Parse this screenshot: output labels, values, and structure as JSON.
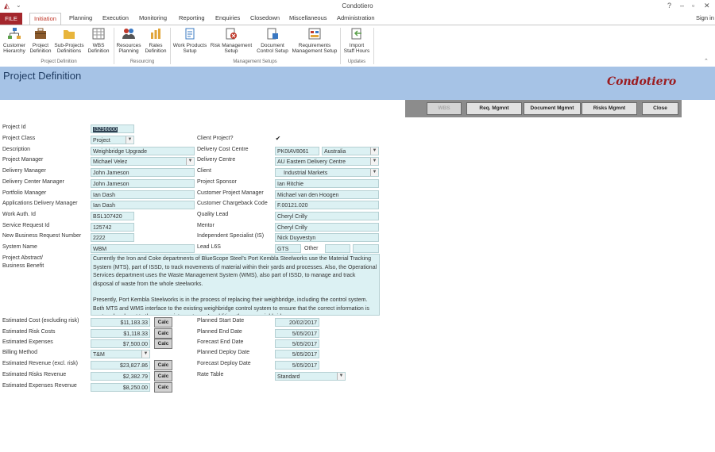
{
  "app": {
    "title": "Condotiero",
    "help": "?",
    "sign_in": "Sign in"
  },
  "tabs": [
    "FILE",
    "Initiation",
    "Planning",
    "Execution",
    "Monitoring",
    "Reporting",
    "Enquiries",
    "Closedown",
    "Miscellaneous",
    "Administration"
  ],
  "ribbon": {
    "buttons": [
      {
        "line1": "Customer",
        "line2": "Hierarchy"
      },
      {
        "line1": "Project",
        "line2": "Definition"
      },
      {
        "line1": "Sub-Projects",
        "line2": "Definitions"
      },
      {
        "line1": "WBS",
        "line2": "Definition"
      },
      {
        "line1": "Resources",
        "line2": "Planning"
      },
      {
        "line1": "Rates",
        "line2": "Definition"
      },
      {
        "line1": "Work Products",
        "line2": "Setup"
      },
      {
        "line1": "Risk Management",
        "line2": "Setup"
      },
      {
        "line1": "Document",
        "line2": "Control Setup"
      },
      {
        "line1": "Requirements",
        "line2": "Management Setup"
      },
      {
        "line1": "Import",
        "line2": "Staff Hours"
      }
    ],
    "groups": [
      "Project Definition",
      "Resourcing",
      "Management Setups",
      "Updates"
    ]
  },
  "header": {
    "title": "Project Definition",
    "logo": "Condotiero"
  },
  "actions": [
    "WBS",
    "Req. Mgmnt",
    "Document Mgmnt",
    "Risks Mgmnt",
    "Close"
  ],
  "left_fields": [
    {
      "label": "Project Id",
      "value": "I3296000"
    },
    {
      "label": "Project Class",
      "value": "Project"
    },
    {
      "label": "Description",
      "value": "Weighbridge Upgrade"
    },
    {
      "label": "Project Manager",
      "value": "Michael Velez"
    },
    {
      "label": "Delivery Manager",
      "value": "John Jameson"
    },
    {
      "label": "Delivery Center Manager",
      "value": "John Jameson"
    },
    {
      "label": "Portfolio Manager",
      "value": "Ian Dash"
    },
    {
      "label": "Applications Delivery Manager",
      "value": "Ian Dash"
    },
    {
      "label": "Work Auth. Id",
      "value": "BSL107420"
    },
    {
      "label": "Service Request Id",
      "value": "125742"
    },
    {
      "label": "New Business Request Number",
      "value": "2222"
    },
    {
      "label": "System Name",
      "value": "WBM"
    }
  ],
  "right_fields": [
    {
      "label": "Client Project?",
      "value": "✔"
    },
    {
      "label": "Delivery Cost Centre",
      "value": "PK0IAV8061",
      "value2": "Australia"
    },
    {
      "label": "Delivery Centre",
      "value": "AU Eastern Delivery Centre"
    },
    {
      "label": "Client",
      "value": "Industrial Markets"
    },
    {
      "label": "Project Sponsor",
      "value": "Ian Ritchie"
    },
    {
      "label": "Customer Project Manager",
      "value": "Michael van den Hoogen"
    },
    {
      "label": "Customer Chargeback Code",
      "value": "F.00121.020"
    },
    {
      "label": "Quality Lead",
      "value": "Cheryl Crilly"
    },
    {
      "label": "Mentor",
      "value": "Cheryl Crilly"
    },
    {
      "label": "Independent Specialist (IS)",
      "value": "Nick Duyvestyn"
    },
    {
      "label": "Lead L6S",
      "value": "GTS",
      "value2": "Other"
    }
  ],
  "abstract": {
    "label1": "Project Abstract/",
    "label2": "Business Benefit",
    "para1": "Currently the Iron and Coke departments of BlueScope Steel's Port Kembla Steelworks use the Material Tracking System (MTS), part of ISSD, to track movements of material within their yards and processes. Also, the Operational Services department uses the Waste Management System (WMS), also part of ISSD, to manage and track disposal of waste from the whole steelworks.",
    "para2": "Presently, Port Kembla Steelworks is in the process of replacing their weighbridge, including the control system. Both MTS and WMS interface to the existing weighbridge control system to ensure that the correct information is captured and sent to the appropriate systems. In addition, the new weighbridge"
  },
  "finance": [
    {
      "label": "Estimated Cost (excluding risk)",
      "value": "$11,183.33",
      "calc": "Calc"
    },
    {
      "label": "Estimated Risk Costs",
      "value": "$1,118.33",
      "calc": "Calc"
    },
    {
      "label": "Estimated Expenses",
      "value": "$7,500.00",
      "calc": "Calc"
    },
    {
      "label": "Billing Method",
      "value": "T&M"
    },
    {
      "label": "Estimated Revenue (excl. risk)",
      "value": "$23,827.86",
      "calc": "Calc"
    },
    {
      "label": "Estimated Risks Revenue",
      "value": "$2,382.79",
      "calc": "Calc"
    },
    {
      "label": "Estimated Expenses Revenue",
      "value": "$8,250.00",
      "calc": "Calc"
    }
  ],
  "dates": [
    {
      "label": "Planned Start Date",
      "value": "20/02/2017"
    },
    {
      "label": "Planned End Date",
      "value": "5/05/2017"
    },
    {
      "label": "Forecast End Date",
      "value": "5/05/2017"
    },
    {
      "label": "Planned Deploy Date",
      "value": "5/05/2017"
    },
    {
      "label": "Forecast Deploy Date",
      "value": "5/05/2017"
    },
    {
      "label": "Rate Table",
      "value": "Standard"
    }
  ]
}
